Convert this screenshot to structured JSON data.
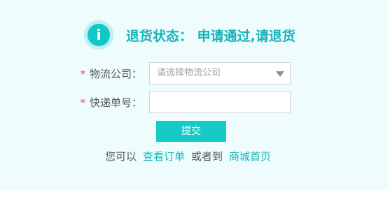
{
  "status": {
    "icon": "info-icon",
    "icon_glyph": "i",
    "label": "退货状态：",
    "message": "申请通过,请退货"
  },
  "form": {
    "required_mark": "*",
    "courier": {
      "label": "物流公司：",
      "placeholder": "请选择物流公司"
    },
    "tracking": {
      "label": "快递单号：",
      "value": ""
    },
    "submit_label": "提交"
  },
  "links": {
    "prefix": "您可以",
    "view_order": "查看订单",
    "middle": "或者到",
    "mall_home": "商城首页"
  },
  "colors": {
    "accent": "#16cbc7",
    "status_text": "#18b4bc",
    "link": "#14b8b8",
    "required": "#e0494e",
    "panel_bg": "#eefcfd"
  }
}
